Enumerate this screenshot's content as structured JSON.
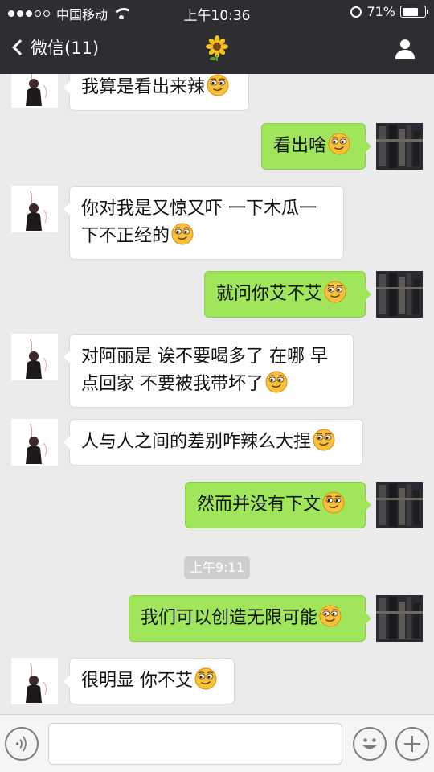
{
  "status_bar": {
    "carrier": "中国移动",
    "time": "上午10:36",
    "battery_percent": "71%",
    "battery_level": 0.71
  },
  "nav": {
    "back_label": "微信(11)",
    "title_icon": "sunflower-icon",
    "right_icon": "user-profile-icon"
  },
  "messages": [
    {
      "side": "left",
      "text": "我算是看出来辣"
    },
    {
      "side": "right",
      "text": "看出啥"
    },
    {
      "side": "left",
      "line1": "你对我是又惊又吓 一下木瓜一",
      "line2": "下不正经的"
    },
    {
      "side": "right",
      "text": "就问你艾不艾"
    },
    {
      "side": "left",
      "line1": "对阿丽是 诶不要喝多了 在哪 早",
      "line2": "点回家 不要被我带坏了"
    },
    {
      "side": "left",
      "text": "人与人之间的差别咋辣么大捏"
    },
    {
      "side": "right",
      "text": "然而并没有下文"
    },
    {
      "side": "right",
      "text": "我们可以创造无限可能"
    },
    {
      "side": "left",
      "text": "很明显 你不艾"
    }
  ],
  "timestamp": "上午9:11",
  "emoji_name": "smirk-emoji",
  "input": {
    "placeholder": ""
  },
  "colors": {
    "nav_bg": "#2e2e32",
    "chat_bg": "#ebebeb",
    "sent_bubble": "#9fe65a",
    "received_bubble": "#ffffff"
  }
}
